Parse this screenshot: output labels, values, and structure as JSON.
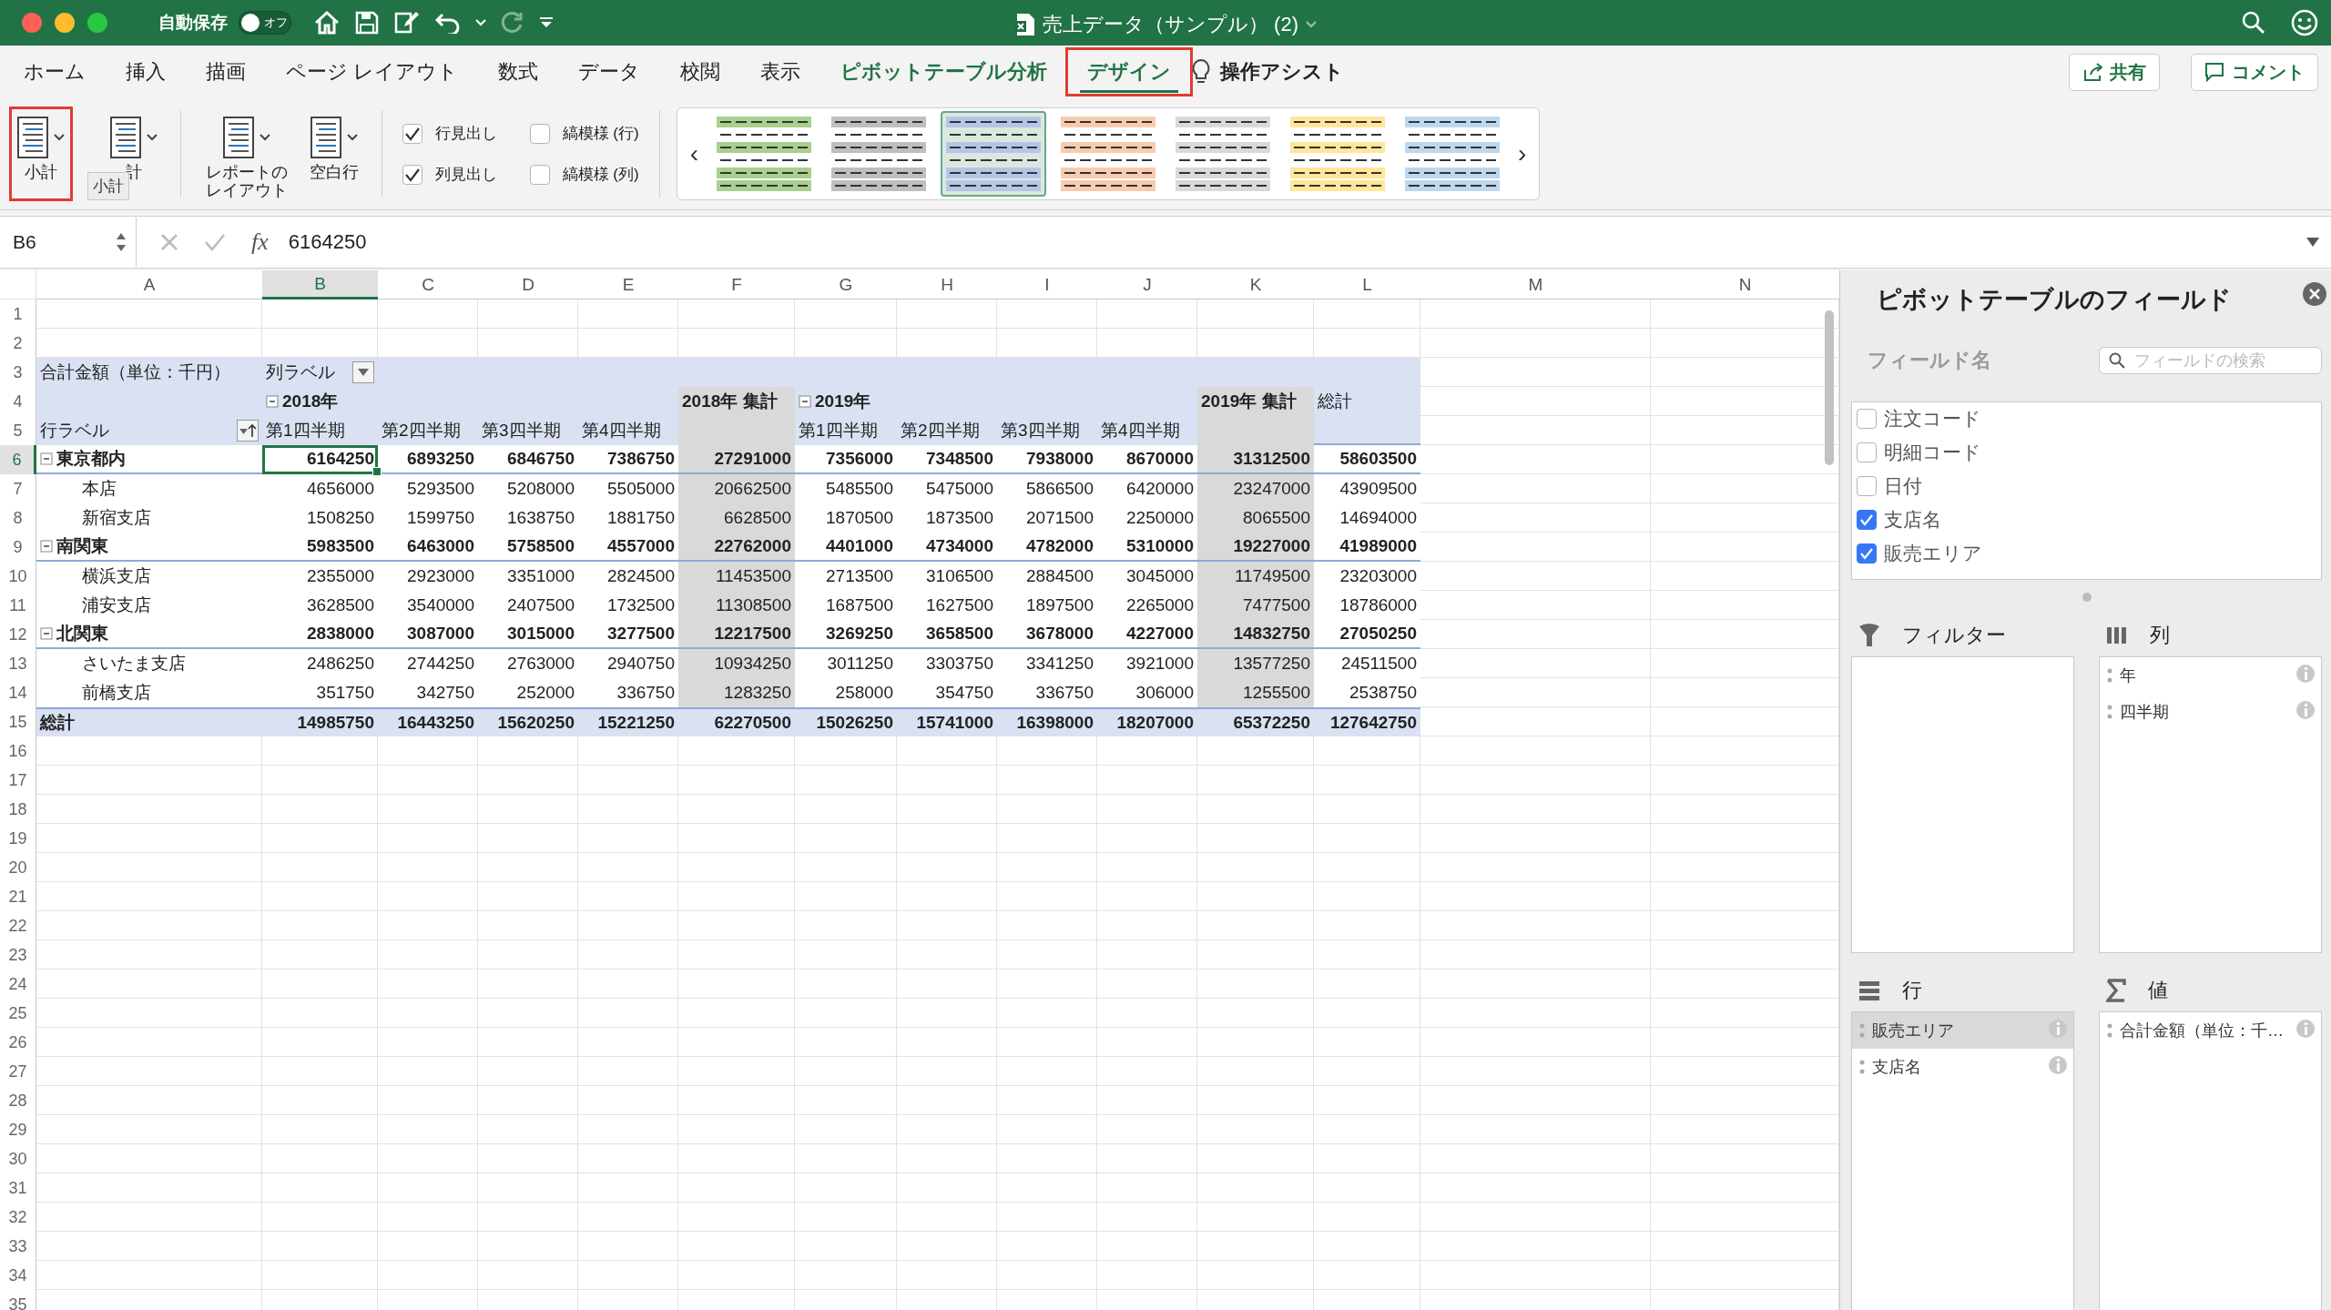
{
  "titlebar": {
    "autosave": {
      "label": "自動保存",
      "on": false,
      "state_text": "オフ"
    },
    "title": "売上データ（サンプル） (2)"
  },
  "tabs": [
    {
      "label": "ホーム",
      "kind": "standard",
      "selected": false,
      "outlined": false
    },
    {
      "label": "挿入",
      "kind": "standard",
      "selected": false,
      "outlined": false
    },
    {
      "label": "描画",
      "kind": "standard",
      "selected": false,
      "outlined": false
    },
    {
      "label": "ページ レイアウト",
      "kind": "standard",
      "selected": false,
      "outlined": false
    },
    {
      "label": "数式",
      "kind": "standard",
      "selected": false,
      "outlined": false
    },
    {
      "label": "データ",
      "kind": "standard",
      "selected": false,
      "outlined": false
    },
    {
      "label": "校閲",
      "kind": "standard",
      "selected": false,
      "outlined": false
    },
    {
      "label": "表示",
      "kind": "standard",
      "selected": false,
      "outlined": false
    },
    {
      "label": "ピボットテーブル分析",
      "kind": "contextual",
      "selected": false,
      "outlined": false
    },
    {
      "label": "デザイン",
      "kind": "contextual",
      "selected": true,
      "outlined": true
    }
  ],
  "assist": "操作アシスト",
  "share_button": "共有",
  "comment_button": "コメント",
  "ribbon": {
    "layout_buttons": [
      {
        "label": "小計",
        "outlined": true
      },
      {
        "label": "計",
        "outlined": false
      },
      {
        "label": "レポートのレイアウト",
        "outlined": false
      },
      {
        "label": "空白行",
        "outlined": false
      }
    ],
    "tooltip": "小計",
    "options": [
      {
        "label": "行見出し",
        "checked": true
      },
      {
        "label": "縞模様 (行)",
        "checked": false
      },
      {
        "label": "列見出し",
        "checked": true
      },
      {
        "label": "縞模様 (列)",
        "checked": false
      }
    ],
    "styles": [
      {
        "color": "#a9d08e",
        "selected": false
      },
      {
        "color": "#bfbfbf",
        "selected": false
      },
      {
        "color": "#b4c6e7",
        "selected": true
      },
      {
        "color": "#f8cbad",
        "selected": false
      },
      {
        "color": "#d9d9d9",
        "selected": false
      },
      {
        "color": "#ffe699",
        "selected": false
      },
      {
        "color": "#bdd7ee",
        "selected": false
      }
    ],
    "prev": "‹",
    "next": "›"
  },
  "formula_bar": {
    "name_box": "B6",
    "function_label": "fx",
    "formula": "6164250"
  },
  "sheet": {
    "columns": [
      {
        "label": "A",
        "kind": "label",
        "selected": false
      },
      {
        "label": "B",
        "kind": "value",
        "selected": true
      },
      {
        "label": "C",
        "kind": "value",
        "selected": false
      },
      {
        "label": "D",
        "kind": "value",
        "selected": false
      },
      {
        "label": "E",
        "kind": "value",
        "selected": false
      },
      {
        "label": "F",
        "kind": "subtotal",
        "selected": false
      },
      {
        "label": "G",
        "kind": "value",
        "selected": false
      },
      {
        "label": "H",
        "kind": "value",
        "selected": false
      },
      {
        "label": "I",
        "kind": "value",
        "selected": false
      },
      {
        "label": "J",
        "kind": "value",
        "selected": false
      },
      {
        "label": "K",
        "kind": "subtotal",
        "selected": false
      },
      {
        "label": "L",
        "kind": "total",
        "selected": false
      },
      {
        "label": "M",
        "kind": "empty",
        "selected": false
      },
      {
        "label": "N",
        "kind": "empty",
        "selected": false
      }
    ],
    "rows": [
      {
        "number": "1",
        "selected": false
      },
      {
        "number": "2",
        "selected": false
      },
      {
        "number": "3",
        "selected": false,
        "kind": "title",
        "cells": [
          "合計金額（単位：千円）",
          {
            "text": "列ラベル",
            "menu": true,
            "sorted": false
          },
          null,
          null,
          null,
          null,
          null,
          null,
          null,
          null,
          null,
          null
        ]
      },
      {
        "number": "4",
        "selected": false,
        "kind": "header",
        "cells": [
          null,
          {
            "text": "2018年",
            "expanded": true
          },
          null,
          null,
          null,
          "2018年 集計",
          {
            "text": "2019年",
            "expanded": true
          },
          null,
          null,
          null,
          "2019年 集計",
          "総計"
        ]
      },
      {
        "number": "5",
        "selected": false,
        "kind": "labels",
        "cells": [
          {
            "text": "行ラベル",
            "menu": true,
            "sorted": true
          },
          "第1四半期",
          "第2四半期",
          "第3四半期",
          "第4四半期",
          null,
          "第1四半期",
          "第2四半期",
          "第3四半期",
          "第4四半期",
          null,
          null
        ]
      },
      {
        "number": "6",
        "selected": true,
        "kind": "area",
        "cells": [
          {
            "text": "東京都内",
            "expanded": true
          },
          "6164250",
          "6893250",
          "6846750",
          "7386750",
          "27291000",
          "7356000",
          "7348500",
          "7938000",
          "8670000",
          "31312500",
          "58603500"
        ]
      },
      {
        "number": "7",
        "selected": false,
        "kind": "detail",
        "cells": [
          "本店",
          "4656000",
          "5293500",
          "5208000",
          "5505000",
          "20662500",
          "5485500",
          "5475000",
          "5866500",
          "6420000",
          "23247000",
          "43909500"
        ]
      },
      {
        "number": "8",
        "selected": false,
        "kind": "detail",
        "cells": [
          "新宿支店",
          "1508250",
          "1599750",
          "1638750",
          "1881750",
          "6628500",
          "1870500",
          "1873500",
          "2071500",
          "2250000",
          "8065500",
          "14694000"
        ]
      },
      {
        "number": "9",
        "selected": false,
        "kind": "area",
        "cells": [
          {
            "text": "南関東",
            "expanded": true
          },
          "5983500",
          "6463000",
          "5758500",
          "4557000",
          "22762000",
          "4401000",
          "4734000",
          "4782000",
          "5310000",
          "19227000",
          "41989000"
        ]
      },
      {
        "number": "10",
        "selected": false,
        "kind": "detail",
        "cells": [
          "横浜支店",
          "2355000",
          "2923000",
          "3351000",
          "2824500",
          "11453500",
          "2713500",
          "3106500",
          "2884500",
          "3045000",
          "11749500",
          "23203000"
        ]
      },
      {
        "number": "11",
        "selected": false,
        "kind": "detail",
        "cells": [
          "浦安支店",
          "3628500",
          "3540000",
          "2407500",
          "1732500",
          "11308500",
          "1687500",
          "1627500",
          "1897500",
          "2265000",
          "7477500",
          "18786000"
        ]
      },
      {
        "number": "12",
        "selected": false,
        "kind": "area",
        "cells": [
          {
            "text": "北関東",
            "expanded": true
          },
          "2838000",
          "3087000",
          "3015000",
          "3277500",
          "12217500",
          "3269250",
          "3658500",
          "3678000",
          "4227000",
          "14832750",
          "27050250"
        ]
      },
      {
        "number": "13",
        "selected": false,
        "kind": "detail",
        "cells": [
          "さいたま支店",
          "2486250",
          "2744250",
          "2763000",
          "2940750",
          "10934250",
          "3011250",
          "3303750",
          "3341250",
          "3921000",
          "13577250",
          "24511500"
        ]
      },
      {
        "number": "14",
        "selected": false,
        "kind": "detail",
        "cells": [
          "前橋支店",
          "351750",
          "342750",
          "252000",
          "336750",
          "1283250",
          "258000",
          "354750",
          "336750",
          "306000",
          "1255500",
          "2538750"
        ]
      },
      {
        "number": "15",
        "selected": false,
        "kind": "total",
        "cells": [
          "総計",
          "14985750",
          "16443250",
          "15620250",
          "15221250",
          "62270500",
          "15026250",
          "15741000",
          "16398000",
          "18207000",
          "65372250",
          "127642750"
        ]
      },
      {
        "number": "16",
        "selected": false
      },
      {
        "number": "17",
        "selected": false
      },
      {
        "number": "18",
        "selected": false
      },
      {
        "number": "19",
        "selected": false
      },
      {
        "number": "20",
        "selected": false
      },
      {
        "number": "21",
        "selected": false
      },
      {
        "number": "22",
        "selected": false
      },
      {
        "number": "23",
        "selected": false
      },
      {
        "number": "24",
        "selected": false
      },
      {
        "number": "25",
        "selected": false
      },
      {
        "number": "26",
        "selected": false
      },
      {
        "number": "27",
        "selected": false
      },
      {
        "number": "28",
        "selected": false
      },
      {
        "number": "29",
        "selected": false
      },
      {
        "number": "30",
        "selected": false
      },
      {
        "number": "31",
        "selected": false
      },
      {
        "number": "32",
        "selected": false
      },
      {
        "number": "33",
        "selected": false
      },
      {
        "number": "34",
        "selected": false
      },
      {
        "number": "35",
        "selected": false
      }
    ]
  },
  "panel": {
    "title": "ピボットテーブルのフィールド",
    "field_name_label": "フィールド名",
    "search": {
      "placeholder": "フィールドの検索"
    },
    "fields": [
      {
        "label": "注文コード",
        "checked": false
      },
      {
        "label": "明細コード",
        "checked": false
      },
      {
        "label": "日付",
        "checked": false
      },
      {
        "label": "支店名",
        "checked": true
      },
      {
        "label": "販売エリア",
        "checked": true
      }
    ],
    "areas": [
      {
        "kind": "filter",
        "title": "フィルター"
      },
      {
        "kind": "columns",
        "title": "列",
        "items": [
          {
            "label": "年",
            "selected": false
          },
          {
            "label": "四半期",
            "selected": false
          }
        ]
      },
      {
        "kind": "rows",
        "title": "行",
        "items": [
          {
            "label": "販売エリア",
            "selected": true
          },
          {
            "label": "支店名",
            "selected": false
          }
        ]
      },
      {
        "kind": "values",
        "title": "値",
        "items": [
          {
            "label": "合計金額（単位：千…",
            "selected": false
          }
        ]
      }
    ]
  }
}
